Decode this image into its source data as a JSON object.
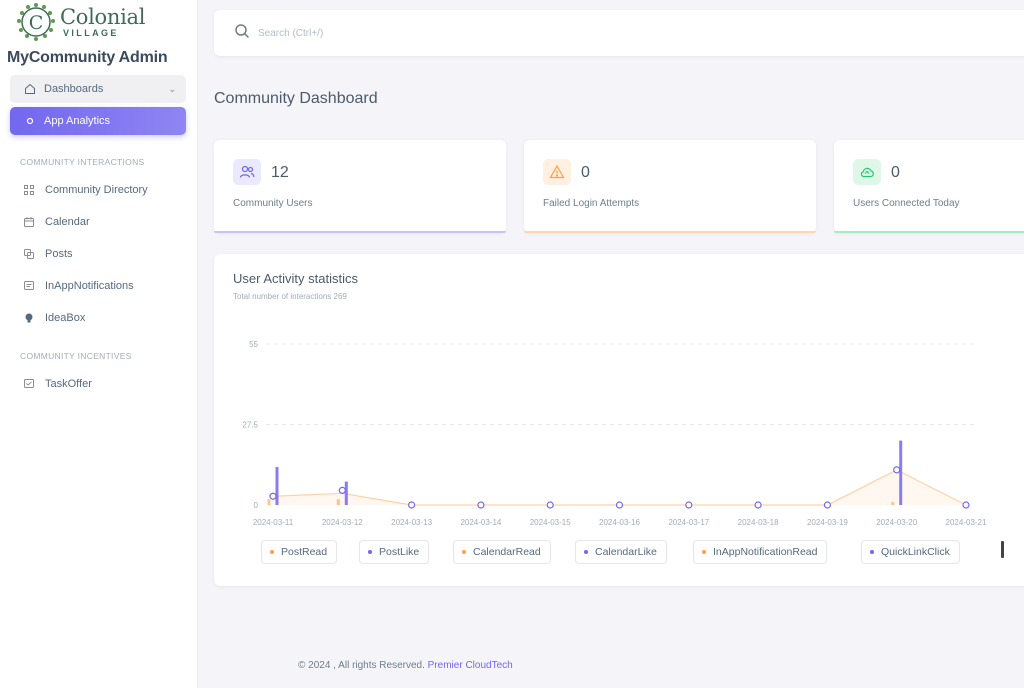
{
  "brand": {
    "logo_letter": "C",
    "logo_name": "Colonial",
    "logo_sub": "VILLAGE",
    "admin_title": "MyCommunity Admin"
  },
  "sidebar": {
    "dashboards": {
      "label": "Dashboards",
      "icon": "home-icon"
    },
    "active": {
      "label": "App Analytics",
      "icon": "circle-icon"
    },
    "sections": [
      {
        "label": "COMMUNITY INTERACTIONS",
        "items": [
          {
            "label": "Community Directory",
            "icon": "directory-icon"
          },
          {
            "label": "Calendar",
            "icon": "calendar-icon"
          },
          {
            "label": "Posts",
            "icon": "posts-icon"
          },
          {
            "label": "InAppNotifications",
            "icon": "notification-icon"
          },
          {
            "label": "IdeaBox",
            "icon": "lightbulb-icon"
          }
        ]
      },
      {
        "label": "COMMUNITY INCENTIVES",
        "items": [
          {
            "label": "TaskOffer",
            "icon": "task-icon"
          }
        ]
      }
    ]
  },
  "search": {
    "placeholder": "Search (Ctrl+/)"
  },
  "page_title": "Community Dashboard",
  "stats": [
    {
      "value": "12",
      "label": "Community Users",
      "icon": "users-icon",
      "color": "#7367f0"
    },
    {
      "value": "0",
      "label": "Failed Login Attempts",
      "icon": "warning-icon",
      "color": "#ff9f43"
    },
    {
      "value": "0",
      "label": "Users Connected Today",
      "icon": "cloud-icon",
      "color": "#28c76f"
    }
  ],
  "chart": {
    "title": "User Activity statistics",
    "subtitle": "Total number of interactions 269"
  },
  "chart_data": {
    "type": "bar",
    "categories": [
      "2024-03-11",
      "2024-03-12",
      "2024-03-13",
      "2024-03-14",
      "2024-03-15",
      "2024-03-16",
      "2024-03-17",
      "2024-03-18",
      "2024-03-19",
      "2024-03-20",
      "2024-03-21"
    ],
    "y_ticks": [
      "0",
      "27.5",
      "55"
    ],
    "ylim": [
      0,
      55
    ],
    "grid": true,
    "series": [
      {
        "name": "PostRead",
        "color": "#ff9f43",
        "values": [
          2,
          2,
          0,
          0,
          0,
          0,
          0,
          0,
          0,
          1,
          0
        ]
      },
      {
        "name": "PostLike",
        "color": "#7367f0",
        "values": [
          13,
          8,
          0,
          0,
          0,
          0,
          0,
          0,
          0,
          22,
          0
        ]
      },
      {
        "name": "CalendarRead",
        "color": "#ff9f43",
        "values": [
          0,
          0,
          0,
          0,
          0,
          0,
          0,
          0,
          0,
          0,
          0
        ]
      },
      {
        "name": "CalendarLike",
        "color": "#7367f0",
        "values": [
          0,
          0,
          0,
          0,
          0,
          0,
          0,
          0,
          0,
          0,
          0
        ]
      },
      {
        "name": "InAppNotificationRead",
        "color": "#ff9f43",
        "values": [
          0,
          0,
          0,
          0,
          0,
          0,
          0,
          0,
          0,
          0,
          0
        ]
      },
      {
        "name": "QuickLinkClick",
        "color": "#7367f0",
        "values": [
          0,
          0,
          0,
          0,
          0,
          0,
          0,
          0,
          0,
          0,
          0
        ]
      }
    ],
    "trend": {
      "color": "#ff9f43",
      "values": [
        3,
        4,
        0,
        0,
        0,
        0,
        0,
        0,
        0,
        12,
        0
      ]
    },
    "markers": {
      "color": "#7367f0",
      "values": [
        3,
        5,
        0,
        0,
        0,
        0,
        0,
        0,
        0,
        12,
        0
      ]
    }
  },
  "footer": {
    "text": "© 2024 , All rights Reserved.",
    "link": "Premier CloudTech"
  }
}
